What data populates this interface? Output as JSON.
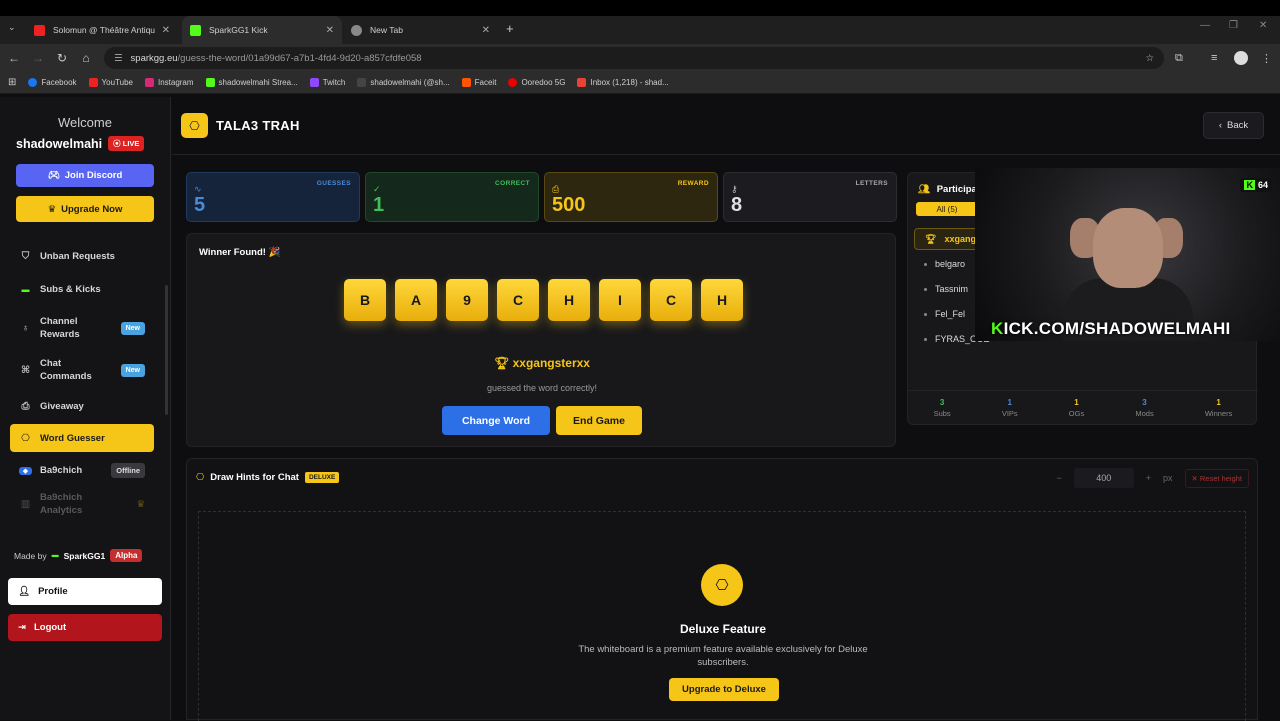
{
  "browser": {
    "tabs": [
      {
        "title": "Solomun @ Théâtre Antiqu",
        "fav": "#e22"
      },
      {
        "title": "SparkGG1 Kick",
        "fav": "#53fc18"
      },
      {
        "title": "New Tab",
        "fav": "#888"
      }
    ],
    "url_host": "sparkgg.eu",
    "url_path": "/guess-the-word/01a99d67-a7b1-4fd4-9d20-a857cfdfe058",
    "bookmarks": [
      {
        "label": "Facebook",
        "color": "#1877f2"
      },
      {
        "label": "YouTube",
        "color": "#e22"
      },
      {
        "label": "Instagram",
        "color": "#d62976"
      },
      {
        "label": "shadowelmahi Strea...",
        "color": "#53fc18"
      },
      {
        "label": "Twitch",
        "color": "#9146ff"
      },
      {
        "label": "shadowelmahi (@sh...",
        "color": "#222"
      },
      {
        "label": "Faceit",
        "color": "#ff5500"
      },
      {
        "label": "Ooredoo 5G",
        "color": "#e00"
      },
      {
        "label": "Inbox (1,218) - shad...",
        "color": "#ea4335"
      }
    ]
  },
  "sidebar": {
    "welcome": "Welcome",
    "username": "shadowelmahi",
    "live": "LIVE",
    "discord": "Join Discord",
    "upgrade": "Upgrade Now",
    "items": [
      {
        "label": "Unban Requests",
        "icon": "shield-icon"
      },
      {
        "label": "Subs & Kicks",
        "icon": "kick-icon"
      },
      {
        "label": "Channel Rewards",
        "icon": "award-icon",
        "badge": "New"
      },
      {
        "label": "Chat Commands",
        "icon": "command-icon",
        "badge": "New"
      },
      {
        "label": "Giveaway",
        "icon": "gift-icon"
      },
      {
        "label": "Word Guesser",
        "icon": "gamepad-icon"
      },
      {
        "label": "Ba9chich",
        "icon": "ba9chich-icon",
        "badge": "Offline"
      },
      {
        "label": "Ba9chich Analytics",
        "icon": "chart-icon"
      }
    ],
    "made_by": "Made by",
    "maker": "SparkGG1",
    "alpha": "Alpha",
    "profile": "Profile",
    "logout": "Logout"
  },
  "header": {
    "title": "TALA3 TRAH",
    "back": "Back"
  },
  "stats": [
    {
      "label": "GUESSES",
      "value": "5",
      "color": "#4a8bd8"
    },
    {
      "label": "CORRECT",
      "value": "1",
      "color": "#3fbf5a"
    },
    {
      "label": "REWARD",
      "value": "500",
      "color": "#f5c518"
    },
    {
      "label": "LETTERS",
      "value": "8",
      "color": "#cfcfcf"
    }
  ],
  "game": {
    "winner_found": "Winner Found! 🎉",
    "letters": [
      "B",
      "A",
      "9",
      "C",
      "H",
      "I",
      "C",
      "H"
    ],
    "winner": "xxgangsterxx",
    "guessed": "guessed the word correctly!",
    "change_word": "Change Word",
    "end_game": "End Game"
  },
  "participants": {
    "title": "Participa",
    "all": "All (5)",
    "list": [
      "xxgangs",
      "belgaro",
      "Tassnim",
      "Fel_Fel",
      "FYRAS_OUE"
    ],
    "stats": [
      {
        "n": "3",
        "label": "Subs",
        "color": "#3fbf5a"
      },
      {
        "n": "1",
        "label": "VIPs",
        "color": "#4a8bd8"
      },
      {
        "n": "1",
        "label": "OGs",
        "color": "#f5c518"
      },
      {
        "n": "3",
        "label": "Mods",
        "color": "#4a8bd8"
      },
      {
        "n": "1",
        "label": "Winners",
        "color": "#f5c518"
      }
    ]
  },
  "hints": {
    "title": "Draw Hints for Chat",
    "deluxe": "DELUXE",
    "height": "400",
    "unit": "px",
    "reset": "Reset height",
    "feature_title": "Deluxe Feature",
    "feature_desc": "The whiteboard is a premium feature available exclusively for Deluxe subscribers.",
    "upgrade": "Upgrade to Deluxe"
  },
  "stream_overlay": {
    "viewers": "64",
    "url_k": "K",
    "url_rest": "ICK.COM/SHADOWELMAHI"
  }
}
